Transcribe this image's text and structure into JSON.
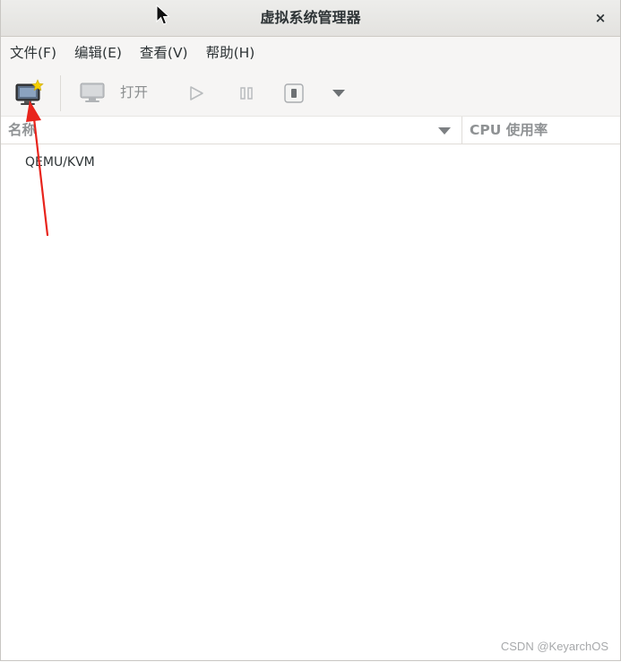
{
  "window": {
    "title": "虚拟系统管理器",
    "close_glyph": "×"
  },
  "menu": [
    {
      "label": "文件(F)"
    },
    {
      "label": "编辑(E)"
    },
    {
      "label": "查看(V)"
    },
    {
      "label": "帮助(H)"
    }
  ],
  "toolbar": {
    "new_vm_icon": "new-vm-icon",
    "console_icon": "monitor-icon",
    "open_label": "打开",
    "run_icon": "play-icon",
    "pause_icon": "pause-icon",
    "shutdown_icon": "power-icon",
    "menu_icon": "dropdown-arrow-icon"
  },
  "columns": {
    "name": "名称",
    "cpu": "CPU 使用率"
  },
  "connections": [
    {
      "label": "QEMU/KVM"
    }
  ],
  "watermark": "CSDN @KeyarchOS",
  "colors": {
    "annotation_arrow": "#e8241c",
    "new_vm_star": "#f5d000"
  }
}
